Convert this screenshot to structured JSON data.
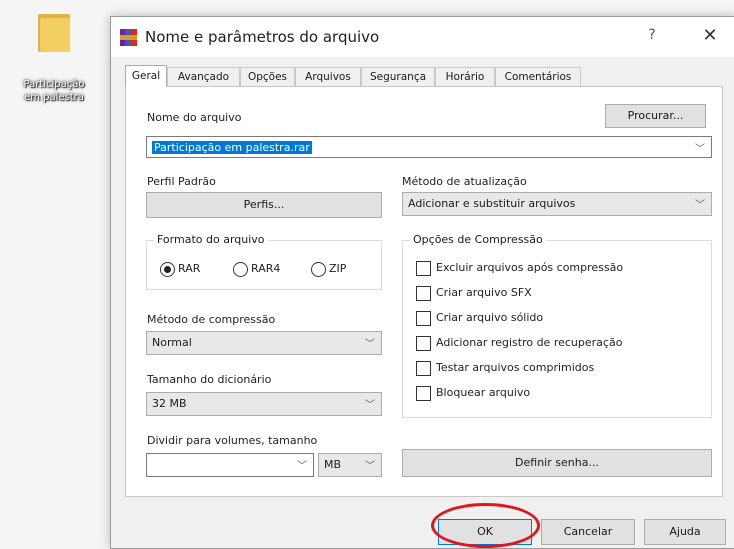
{
  "desktop": {
    "icon_label_line1": "Participação",
    "icon_label_line2": "em palestra"
  },
  "dialog": {
    "title": "Nome e parâmetros do arquivo",
    "help": "?",
    "close": "✕"
  },
  "tabs": [
    "Geral",
    "Avançado",
    "Opções",
    "Arquivos",
    "Segurança",
    "Horário",
    "Comentários"
  ],
  "archive_name": {
    "label": "Nome do arquivo",
    "value": "Participação em palestra.rar",
    "browse": "Procurar..."
  },
  "profile": {
    "label": "Perfil Padrão",
    "button": "Perfis..."
  },
  "update_method": {
    "label": "Método de atualização",
    "value": "Adicionar e substituir arquivos"
  },
  "format": {
    "legend": "Formato do arquivo",
    "options": [
      "RAR",
      "RAR4",
      "ZIP"
    ],
    "selected": "RAR"
  },
  "compression": {
    "label": "Método de compressão",
    "value": "Normal"
  },
  "dictionary": {
    "label": "Tamanho do dicionário",
    "value": "32 MB"
  },
  "split": {
    "label": "Dividir para volumes, tamanho",
    "value": "",
    "unit": "MB"
  },
  "options": {
    "legend": "Opções de Compressão",
    "items": [
      {
        "label": "Excluir arquivos após compressão",
        "checked": false
      },
      {
        "label": "Criar arquivo SFX",
        "checked": false
      },
      {
        "label": "Criar arquivo sólido",
        "checked": false
      },
      {
        "label": "Adicionar registro de recuperação",
        "checked": false
      },
      {
        "label": "Testar arquivos comprimidos",
        "checked": false
      },
      {
        "label": "Bloquear arquivo",
        "checked": false
      }
    ]
  },
  "set_password": "Definir senha...",
  "footer": {
    "ok": "OK",
    "cancel": "Cancelar",
    "help": "Ajuda"
  },
  "colors": {
    "selection": "#0078d7",
    "annotation_ring": "#e0161c"
  }
}
